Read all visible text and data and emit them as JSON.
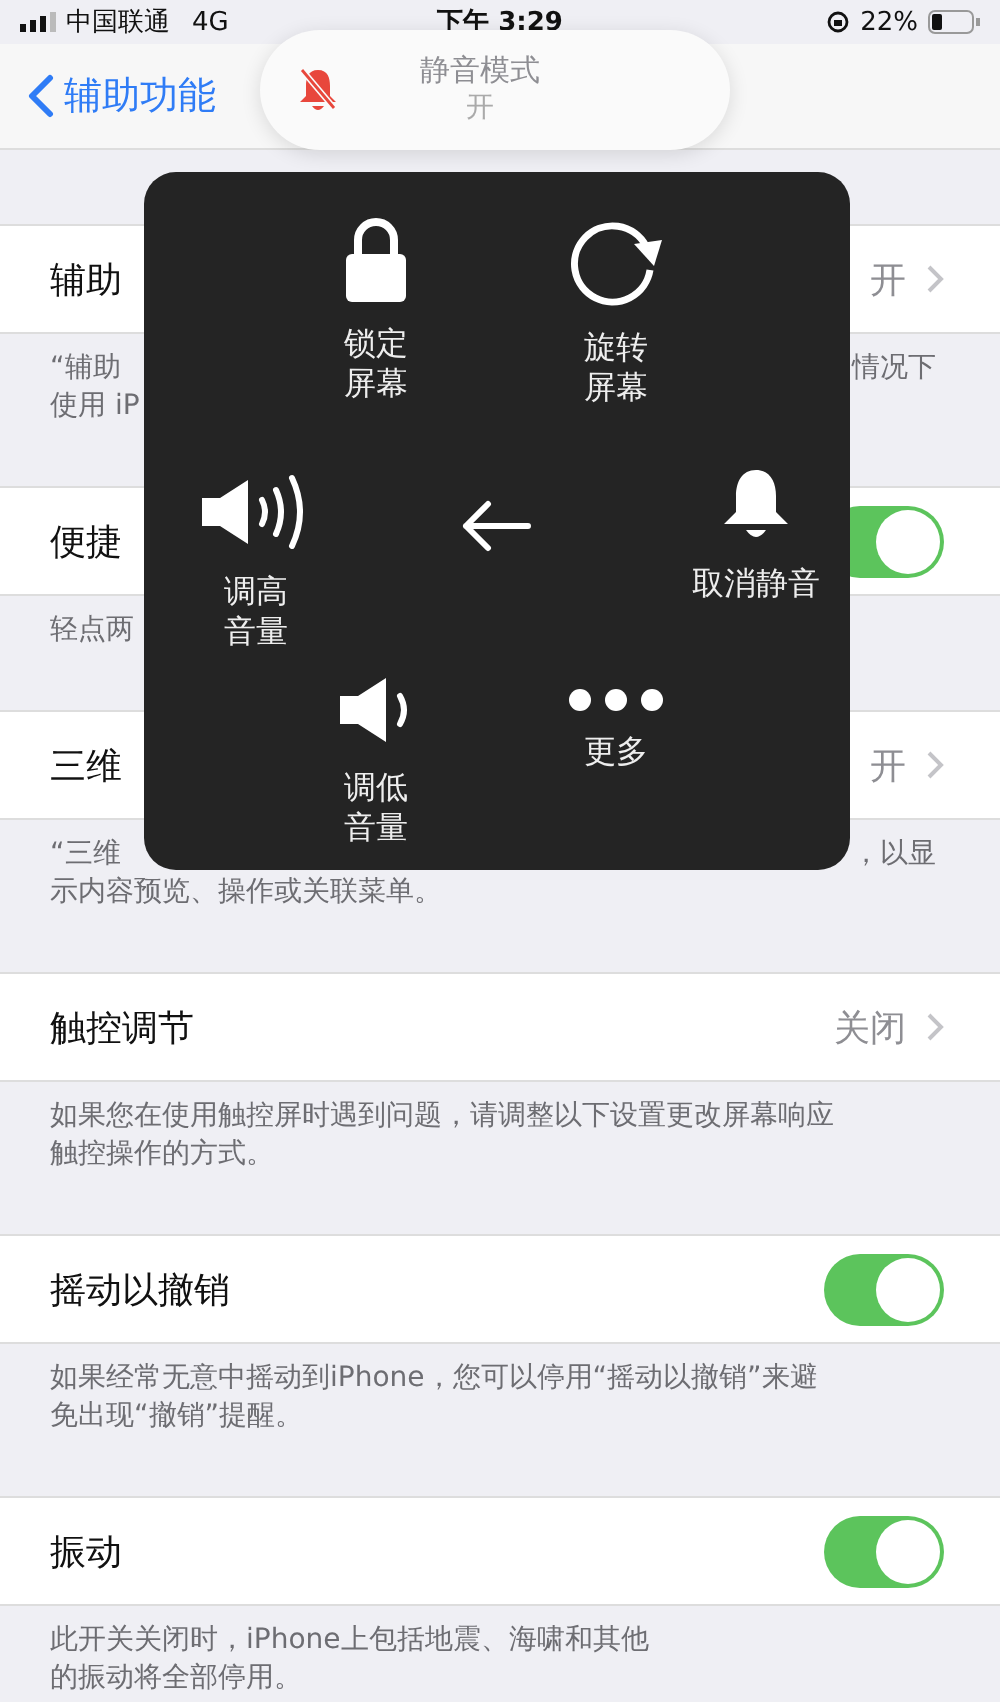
{
  "status_bar": {
    "carrier": "中国联通",
    "network": "4G",
    "time": "下午 3:29",
    "battery": "22%"
  },
  "nav": {
    "back": "辅助功能"
  },
  "banner": {
    "title": "静音模式",
    "value": "开"
  },
  "sections": [
    {
      "kind": "value",
      "label": "辅助",
      "value": "开",
      "desc": [
        {
          "left": "“辅助",
          "right": "情况下"
        },
        {
          "left": "使用 iP"
        }
      ]
    },
    {
      "kind": "toggle",
      "label": "便捷",
      "on": true,
      "desc": [
        {
          "left": "轻点两"
        }
      ]
    },
    {
      "kind": "value",
      "label": "三维",
      "value": "开",
      "desc": [
        {
          "left": "“三维",
          "right": "，以显"
        },
        {
          "left": "示内容预览、操作或关联菜单。"
        }
      ]
    },
    {
      "kind": "value",
      "label": "触控调节",
      "value": "关闭",
      "desc": [
        {
          "left": "如果您在使用触控屏时遇到问题，请调整以下设置更改屏幕响应"
        },
        {
          "left": "触控操作的方式。"
        }
      ]
    },
    {
      "kind": "toggle",
      "label": "摇动以撤销",
      "on": true,
      "desc": [
        {
          "left": "如果经常无意中摇动到iPhone，您可以停用“摇动以撤销”来避"
        },
        {
          "left": "免出现“撤销”提醒。"
        }
      ]
    },
    {
      "kind": "toggle",
      "label": "振动",
      "on": true,
      "desc": [
        {
          "left": "此开关关闭时，iPhone上包括地震、海啸和其他"
        },
        {
          "left": "的振动将全部停用。"
        }
      ]
    }
  ],
  "menu": {
    "items": [
      {
        "kind": "lock",
        "lines": [
          "锁定",
          "屏幕"
        ]
      },
      {
        "kind": "rotate",
        "lines": [
          "旋转",
          "屏幕"
        ]
      },
      {
        "kind": "volume_up",
        "lines": [
          "调高",
          "音量"
        ]
      },
      {
        "kind": "back"
      },
      {
        "kind": "unmute",
        "lines": [
          "取消静音"
        ]
      },
      {
        "kind": "volume_down",
        "lines": [
          "调低",
          "音量"
        ]
      },
      {
        "kind": "more",
        "lines": [
          "更多"
        ]
      }
    ]
  }
}
